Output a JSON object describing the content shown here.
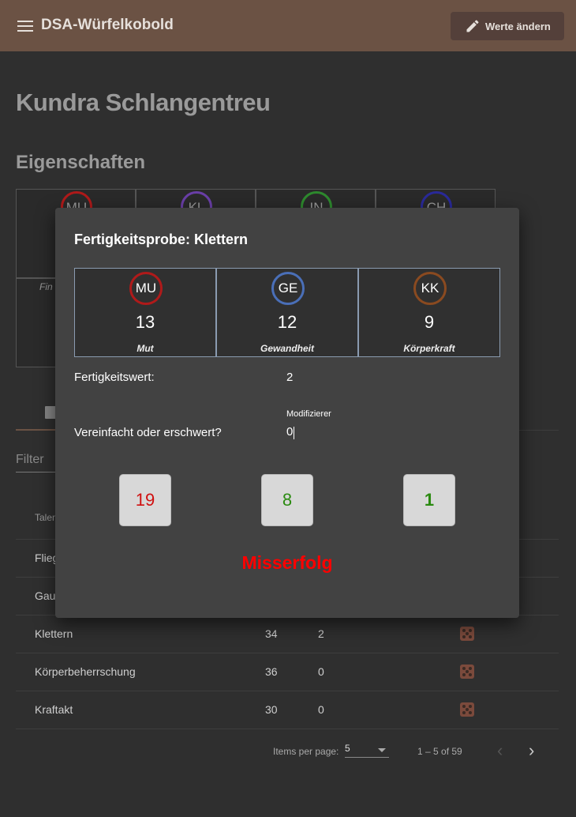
{
  "app": {
    "title": "DSA-Würfelkobold",
    "edit_button": "Werte ändern",
    "menu_icon": "menu-icon",
    "edit_icon": "pencil-icon"
  },
  "character": {
    "name": "Kundra Schlangentreu"
  },
  "attributes_section": {
    "title": "Eigenschaften"
  },
  "attributes": [
    {
      "abbr": "MU",
      "color": "#b01a1a"
    },
    {
      "abbr": "KL",
      "color": "#6a3fa8"
    },
    {
      "abbr": "IN",
      "color": "#2e8a2e"
    },
    {
      "abbr": "CH",
      "color": "#2a2a9a"
    }
  ],
  "attribute_sub_label": "Fin",
  "filter": {
    "placeholder": "Filter"
  },
  "table": {
    "header": {
      "name": "Talen"
    },
    "partial_rows": [
      "Flieg",
      "Gau"
    ],
    "rows": [
      {
        "name": "Klettern",
        "value": "34",
        "fw": "2"
      },
      {
        "name": "Körperbeherrschung",
        "value": "36",
        "fw": "0"
      },
      {
        "name": "Kraftakt",
        "value": "30",
        "fw": "0"
      }
    ]
  },
  "paginator": {
    "label": "Items per page:",
    "page_size": "5",
    "range": "1 – 5 of 59",
    "prev_icon": "chevron-left-icon",
    "next_icon": "chevron-right-icon"
  },
  "dialog": {
    "title": "Fertigkeitsprobe: Klettern",
    "attributes": [
      {
        "abbr": "MU",
        "value": "13",
        "name": "Mut",
        "color": "#b01a1a"
      },
      {
        "abbr": "GE",
        "value": "12",
        "name": "Gewandheit",
        "color": "#4a6fb8"
      },
      {
        "abbr": "KK",
        "value": "9",
        "name": "Körperkraft",
        "color": "#8a4a20"
      }
    ],
    "skill_value_label": "Fertigkeitswert:",
    "skill_value": "2",
    "modifier_label": "Vereinfacht oder erschwert?",
    "modifier_field_label": "Modifizierer",
    "modifier_value": "0",
    "dice": [
      {
        "value": "19",
        "color": "#d01010"
      },
      {
        "value": "8",
        "color": "#2a8a10"
      },
      {
        "value": "1",
        "color": "#2a8a10"
      }
    ],
    "result": "Misserfolg",
    "result_color": "#ff0000"
  }
}
